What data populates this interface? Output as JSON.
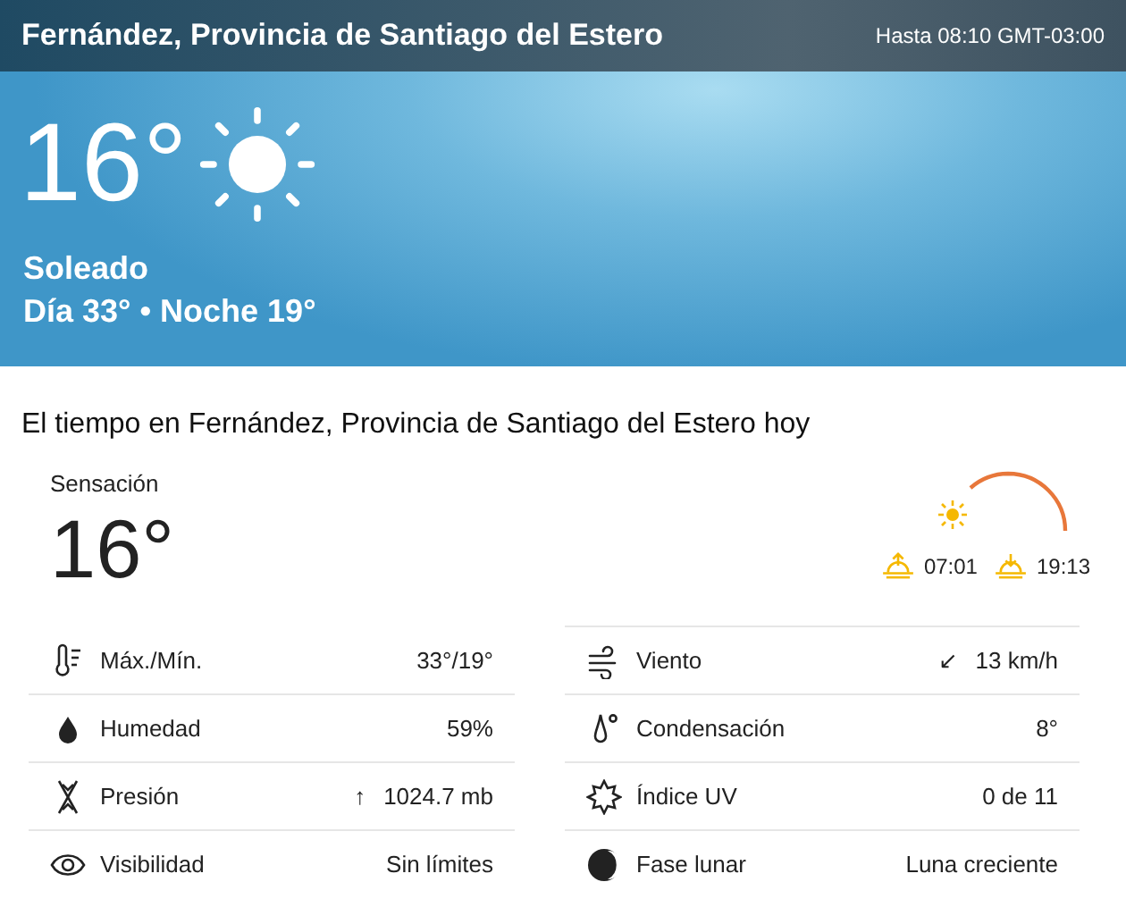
{
  "header": {
    "location": "Fernández, Provincia de Santiago del Estero",
    "valid_until": "Hasta 08:10 GMT-03:00"
  },
  "current": {
    "temperature": "16°",
    "condition": "Soleado",
    "day_night": "Día 33° • Noche 19°"
  },
  "today": {
    "title": "El tiempo en Fernández, Provincia de Santiago del Estero hoy",
    "feels_label": "Sensación",
    "feels_value": "16°",
    "sunrise": "07:01",
    "sunset": "19:13",
    "columns": [
      [
        {
          "kind": "thermometer",
          "label": "Máx./Mín.",
          "value": "33°/19°"
        },
        {
          "kind": "drop",
          "label": "Humedad",
          "value": "59%"
        },
        {
          "kind": "pressure",
          "label": "Presión",
          "arrow": "↑",
          "value": "1024.7 mb"
        },
        {
          "kind": "eye",
          "label": "Visibilidad",
          "value": "Sin límites"
        }
      ],
      [
        {
          "kind": "wind",
          "label": "Viento",
          "arrow": "↙",
          "value": "13 km/h"
        },
        {
          "kind": "dewpoint",
          "label": "Condensación",
          "value": "8°"
        },
        {
          "kind": "uv",
          "label": "Índice UV",
          "value": "0 de 11"
        },
        {
          "kind": "moon",
          "label": "Fase lunar",
          "value": "Luna creciente"
        }
      ]
    ]
  }
}
